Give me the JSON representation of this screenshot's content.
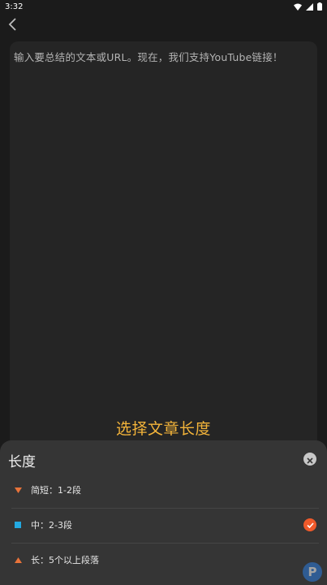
{
  "status_bar": {
    "time": "3:32"
  },
  "header": {
    "back_icon": "chevron-left-icon"
  },
  "input": {
    "placeholder": "输入要总结的文本或URL。现在，我们支持YouTube链接！"
  },
  "select_length": {
    "title": "选择文章长度"
  },
  "sheet": {
    "title": "长度",
    "close_icon": "close-icon",
    "options": [
      {
        "label": "简短：1-2段",
        "icon": "triangle-down-icon",
        "icon_color": "#e8733a",
        "selected": false
      },
      {
        "label": "中：2-3段",
        "icon": "square-icon",
        "icon_color": "#23a9e1",
        "selected": true
      },
      {
        "label": "长：5个以上段落",
        "icon": "triangle-up-icon",
        "icon_color": "#e8733a",
        "selected": false
      }
    ]
  },
  "colors": {
    "accent": "#f3b43a",
    "check": "#ef5a2b",
    "background": "#1b1b1b",
    "sheet": "#353535"
  }
}
